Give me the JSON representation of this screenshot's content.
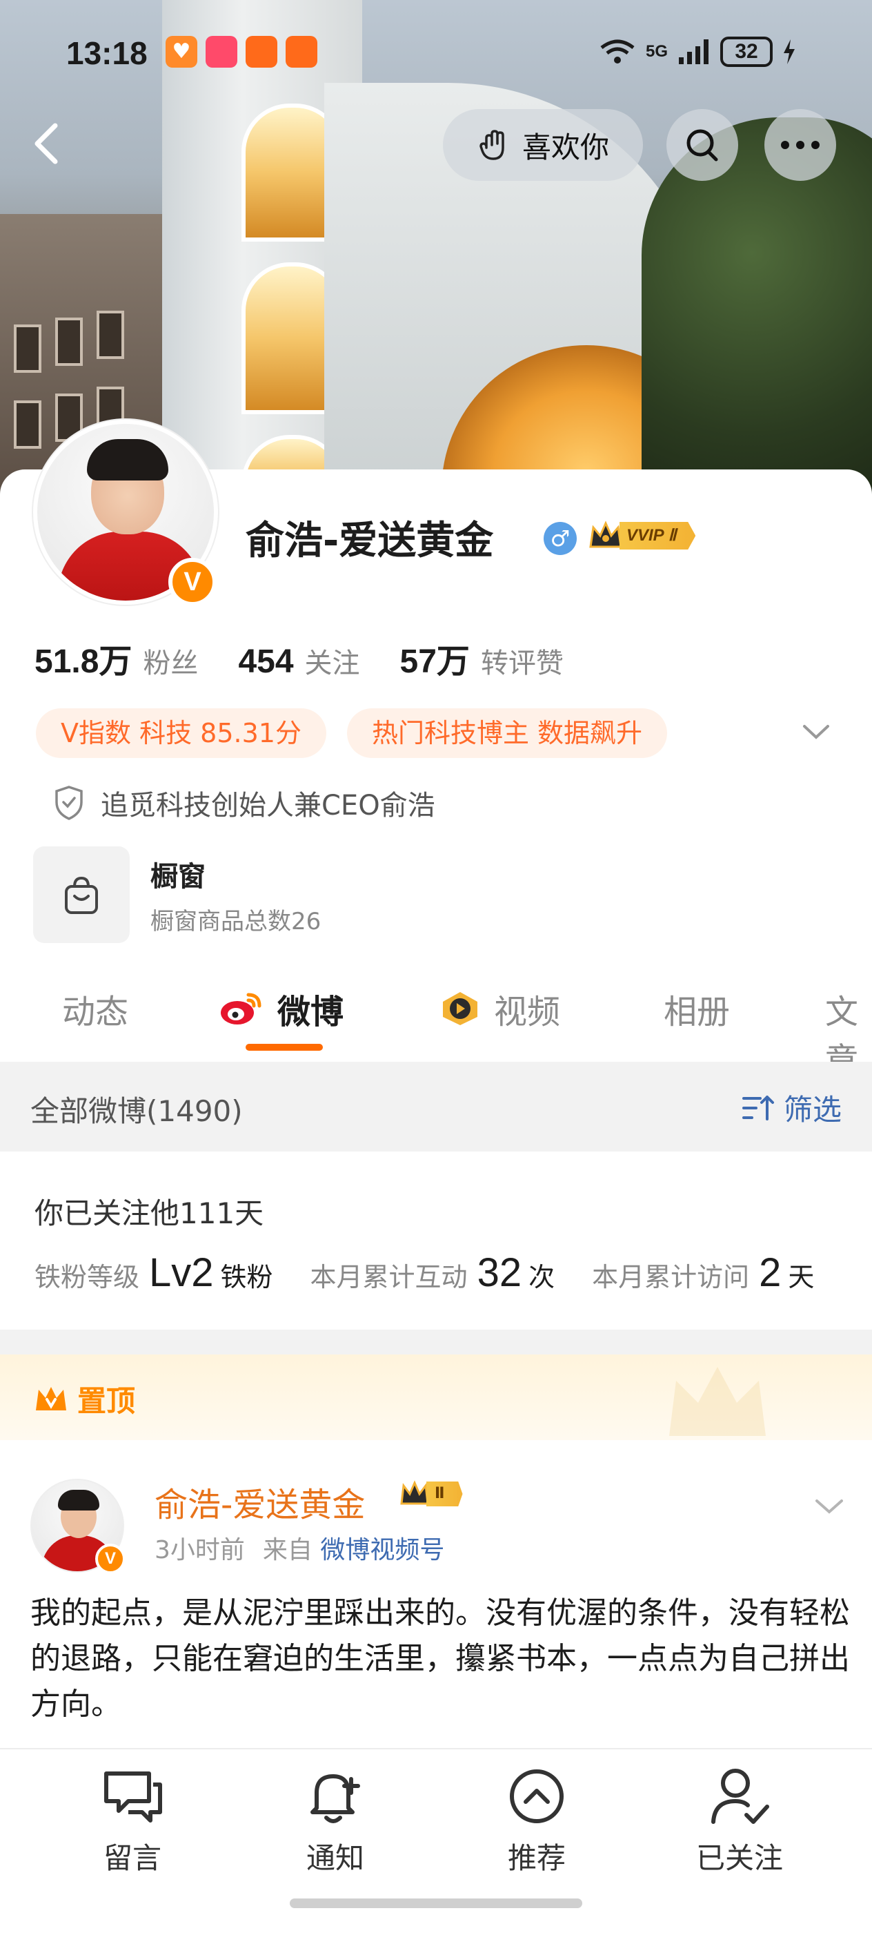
{
  "status_bar": {
    "time": "13:18",
    "network": "5G",
    "battery": "32",
    "badges": [
      {
        "text": "♥",
        "color": "#ff8a2a"
      },
      {
        "text": "",
        "color": "#ff4a6a"
      },
      {
        "text": "",
        "color": "#ff6a1a"
      },
      {
        "text": "",
        "color": "#ff6a1a"
      }
    ]
  },
  "nav": {
    "like_label": "喜欢你"
  },
  "profile": {
    "name": "俞浩-爱送黄金",
    "gender_symbol": "♂",
    "vip_label": "VVIP Ⅱ",
    "verified_mark": "V",
    "stats": [
      {
        "num": "51.8万",
        "label": "粉丝"
      },
      {
        "num": "454",
        "label": "关注"
      },
      {
        "num": "57万",
        "label": "转评赞"
      }
    ],
    "tags": [
      "V指数 科技 85.31分",
      "热门科技博主 数据飙升"
    ],
    "certification": "追觅科技创始人兼CEO俞浩",
    "shop": {
      "title": "橱窗",
      "subtitle": "橱窗商品总数26"
    }
  },
  "tabs": [
    {
      "label": "动态",
      "icon": ""
    },
    {
      "label": "微博",
      "icon": "weibo-icon"
    },
    {
      "label": "视频",
      "icon": "video-icon"
    },
    {
      "label": "相册",
      "icon": ""
    },
    {
      "label": "文章",
      "icon": ""
    }
  ],
  "filter_bar": {
    "all_label": "全部微博(1490)",
    "filter_label": "筛选"
  },
  "fan_info": {
    "follow_days": "你已关注他111天",
    "metrics": [
      {
        "key": "铁粉等级",
        "value": "Lv2",
        "unit": "铁粉"
      },
      {
        "key": "本月累计互动",
        "value": "32",
        "unit": "次"
      },
      {
        "key": "本月累计访问",
        "value": "2",
        "unit": "天"
      }
    ]
  },
  "pinned": {
    "label": "置顶"
  },
  "post": {
    "author": "俞浩-爱送黄金",
    "vip_label": "Ⅱ",
    "time": "3小时前",
    "from_prefix": "来自",
    "source": "微博视频号",
    "body": "我的起点，是从泥泞里踩出来的。没有优渥的条件，没有轻松的退路，只能在窘迫的生活里，攥紧书本，一点点为自己拼出方向。"
  },
  "bottom_bar": [
    {
      "label": "留言",
      "icon": "message-icon"
    },
    {
      "label": "通知",
      "icon": "bell-plus-icon"
    },
    {
      "label": "推荐",
      "icon": "recommend-icon"
    },
    {
      "label": "已关注",
      "icon": "user-check-icon"
    }
  ],
  "colors": {
    "accent": "#ff6a00",
    "link": "#3e6bb1",
    "tag_bg": "#fff1e8",
    "tag_text": "#ff6a2a",
    "name_orange": "#e8731a"
  }
}
